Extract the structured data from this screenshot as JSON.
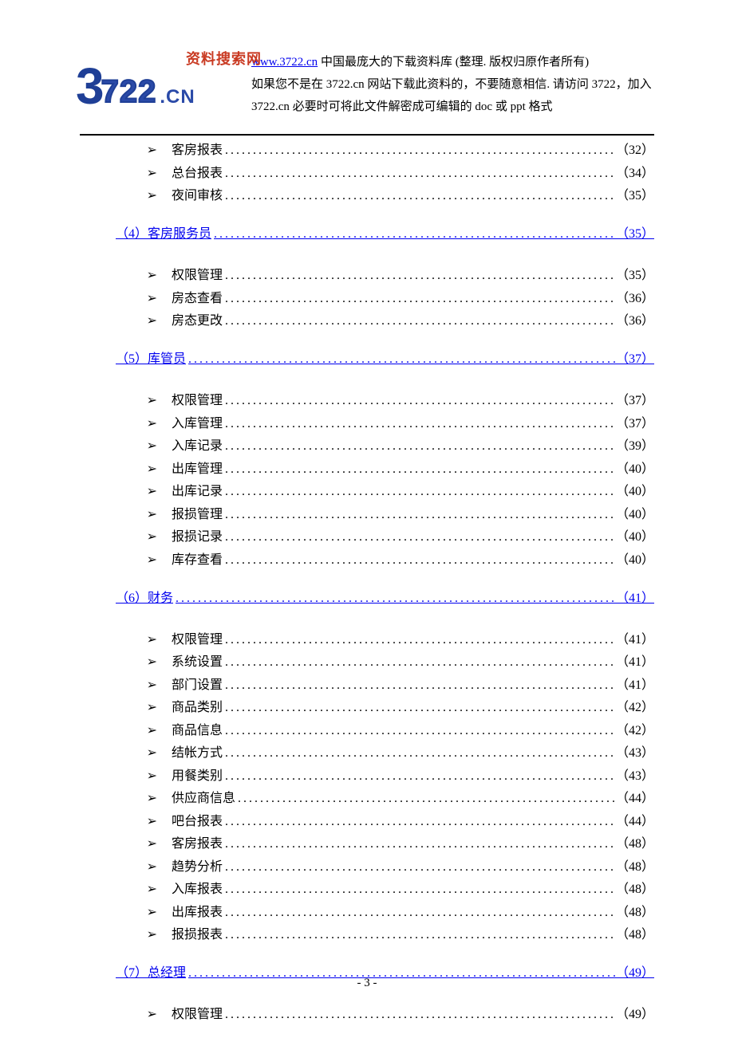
{
  "header": {
    "logo_tag": "资料搜索网",
    "logo_3": "3",
    "logo_722": "722",
    "logo_cn": ".CN",
    "link_text": "www.3722.cn",
    "line1_rest": " 中国最庞大的下载资料库 (整理. 版权归原作者所有)",
    "line2": "如果您不是在 3722.cn 网站下载此资料的，不要随意相信. 请访问 3722，加入",
    "line3": "3722.cn 必要时可将此文件解密成可编辑的 doc 或 ppt 格式"
  },
  "toc": {
    "group0": [
      {
        "label": "客房报表",
        "page": "（32）"
      },
      {
        "label": "总台报表",
        "page": "（34）"
      },
      {
        "label": "夜间审核",
        "page": "（35）"
      }
    ],
    "section4": {
      "label": "（4）客房服务员",
      "page": "（35）"
    },
    "group4": [
      {
        "label": "权限管理",
        "page": "（35）"
      },
      {
        "label": "房态查看",
        "page": "（36）"
      },
      {
        "label": "房态更改",
        "page": "（36）"
      }
    ],
    "section5": {
      "label": "（5）库管员",
      "page": "（37）"
    },
    "group5": [
      {
        "label": "权限管理",
        "page": "（37）"
      },
      {
        "label": "入库管理",
        "page": "（37）"
      },
      {
        "label": "入库记录",
        "page": "（39）"
      },
      {
        "label": "出库管理",
        "page": "（40）"
      },
      {
        "label": "出库记录",
        "page": "（40）"
      },
      {
        "label": "报损管理",
        "page": "（40）"
      },
      {
        "label": "报损记录",
        "page": "（40）"
      },
      {
        "label": "库存查看",
        "page": "（40）"
      }
    ],
    "section6": {
      "label": "（6）财务",
      "page": "（41）"
    },
    "group6": [
      {
        "label": "权限管理",
        "page": "（41）"
      },
      {
        "label": "系统设置",
        "page": "（41）"
      },
      {
        "label": "部门设置",
        "page": "（41）"
      },
      {
        "label": "商品类别",
        "page": "（42）"
      },
      {
        "label": "商品信息",
        "page": "（42）"
      },
      {
        "label": "结帐方式",
        "page": "（43）"
      },
      {
        "label": "用餐类别",
        "page": "（43）"
      },
      {
        "label": "供应商信息",
        "page": "（44）"
      },
      {
        "label": "吧台报表",
        "page": "（44）"
      },
      {
        "label": "客房报表",
        "page": "（48）"
      },
      {
        "label": "趋势分析",
        "page": "（48）"
      },
      {
        "label": "入库报表",
        "page": "（48）"
      },
      {
        "label": "出库报表",
        "page": "（48）"
      },
      {
        "label": "报损报表",
        "page": "（48）"
      }
    ],
    "section7": {
      "label": "（7）总经理",
      "page": "（49）"
    },
    "group7": [
      {
        "label": "权限管理",
        "page": "（49）"
      }
    ]
  },
  "bullet": "➢",
  "dots": "...............................................................................",
  "footer": "- 3 -"
}
